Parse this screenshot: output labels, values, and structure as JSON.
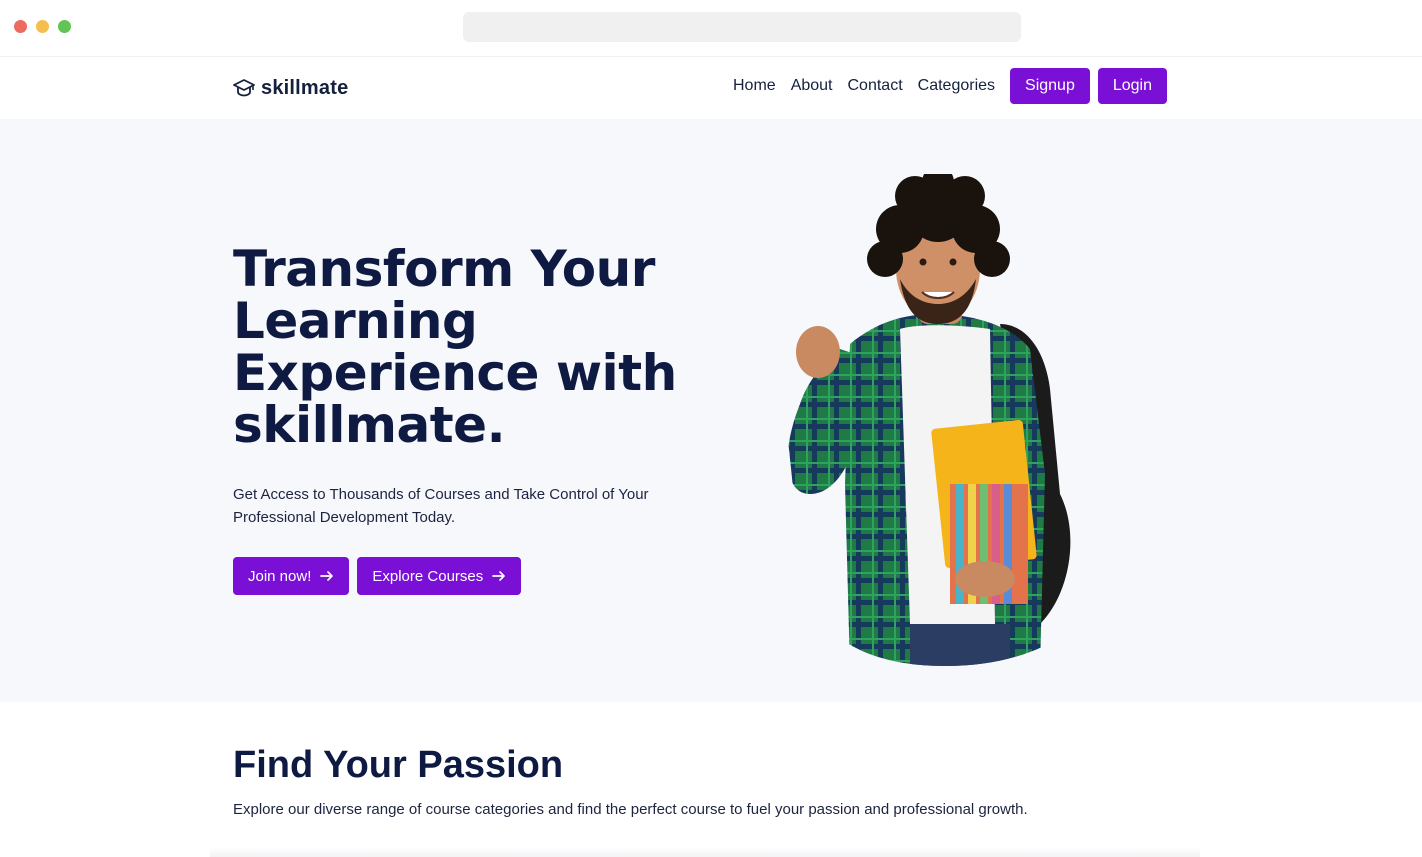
{
  "brand": {
    "name": "skillmate",
    "icon": "graduation-cap-icon"
  },
  "nav": {
    "links": [
      "Home",
      "About",
      "Contact",
      "Categories"
    ],
    "signup_label": "Signup",
    "login_label": "Login"
  },
  "hero": {
    "title_line1": "Transform Your",
    "title_line2": "Learning",
    "title_line3": "Experience with",
    "title_line4": "skillmate.",
    "subtitle": "Get Access to Thousands of Courses and Take Control of Your Professional Development Today.",
    "join_label": "Join now!",
    "explore_label": "Explore Courses",
    "arrow_icon": "arrow-right-icon"
  },
  "section": {
    "title": "Find Your Passion",
    "subtitle": "Explore our diverse range of course categories and find the perfect course to fuel your passion and professional growth."
  },
  "colors": {
    "accent": "#7a0fd6",
    "heading": "#0e1a42",
    "hero_bg": "#f7f8fc"
  }
}
